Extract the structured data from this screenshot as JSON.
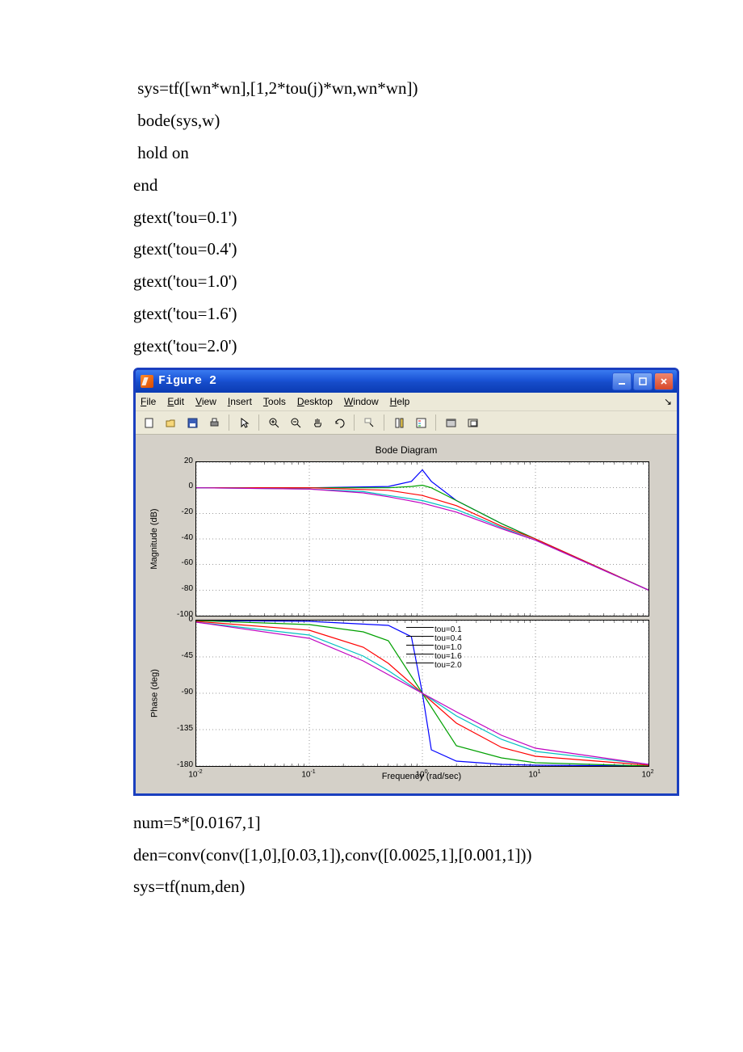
{
  "code_before": [
    " sys=tf([wn*wn],[1,2*tou(j)*wn,wn*wn])",
    " bode(sys,w)",
    " hold on",
    "end",
    "gtext('tou=0.1')",
    "gtext('tou=0.4')",
    "gtext('tou=1.0')",
    "gtext('tou=1.6')",
    "gtext('tou=2.0')"
  ],
  "code_after": [
    "num=5*[0.0167,1]",
    "den=conv(conv([1,0],[0.03,1]),conv([0.0025,1],[0.001,1]))",
    "sys=tf(num,den)"
  ],
  "figure": {
    "title": "Figure 2",
    "menu": [
      "File",
      "Edit",
      "View",
      "Insert",
      "Tools",
      "Desktop",
      "Window",
      "Help"
    ],
    "chart_title": "Bode Diagram"
  },
  "chart_data": [
    {
      "type": "line",
      "title": "Bode Diagram",
      "panel": "Magnitude",
      "ylabel": "Magnitude (dB)",
      "xlabel": "Frequency (rad/sec)",
      "xscale": "log",
      "xlim": [
        0.01,
        100
      ],
      "ylim": [
        -100,
        20
      ],
      "yticks": [
        20,
        0,
        -20,
        -40,
        -60,
        -80,
        -100
      ],
      "xticks": [
        0.01,
        0.1,
        1,
        10,
        100
      ],
      "series": [
        {
          "name": "tou=0.1",
          "color": "#0000ff",
          "x": [
            0.01,
            0.1,
            0.5,
            0.8,
            1,
            1.2,
            2,
            5,
            10,
            100
          ],
          "y": [
            0,
            0,
            1,
            5,
            14,
            5,
            -10,
            -28,
            -40,
            -80
          ]
        },
        {
          "name": "tou=0.4",
          "color": "#00a000",
          "x": [
            0.01,
            0.1,
            0.5,
            0.8,
            1,
            1.2,
            2,
            5,
            10,
            100
          ],
          "y": [
            0,
            0,
            0,
            1,
            2,
            0,
            -10,
            -28,
            -40,
            -80
          ]
        },
        {
          "name": "tou=1.0",
          "color": "#ff0000",
          "x": [
            0.01,
            0.1,
            0.5,
            1,
            2,
            5,
            10,
            100
          ],
          "y": [
            0,
            0,
            -2,
            -6,
            -14,
            -30,
            -40,
            -80
          ]
        },
        {
          "name": "tou=1.6",
          "color": "#00c0c0",
          "x": [
            0.01,
            0.1,
            0.3,
            0.5,
            1,
            2,
            5,
            10,
            100
          ],
          "y": [
            0,
            -1,
            -3,
            -6,
            -10,
            -17,
            -31,
            -41,
            -80
          ]
        },
        {
          "name": "tou=2.0",
          "color": "#c000c0",
          "x": [
            0.01,
            0.1,
            0.3,
            0.5,
            1,
            2,
            5,
            10,
            100
          ],
          "y": [
            0,
            -1,
            -4,
            -7,
            -12,
            -19,
            -32,
            -41,
            -80
          ]
        }
      ]
    },
    {
      "type": "line",
      "panel": "Phase",
      "ylabel": "Phase (deg)",
      "xlabel": "Frequency (rad/sec)",
      "xscale": "log",
      "xlim": [
        0.01,
        100
      ],
      "ylim": [
        -180,
        0
      ],
      "yticks": [
        0,
        -45,
        -90,
        -135,
        -180
      ],
      "xticks": [
        0.01,
        0.1,
        1,
        10,
        100
      ],
      "series": [
        {
          "name": "tou=0.1",
          "color": "#0000ff",
          "x": [
            0.01,
            0.1,
            0.5,
            0.8,
            1,
            1.2,
            2,
            5,
            10,
            100
          ],
          "y": [
            0,
            -1,
            -6,
            -20,
            -90,
            -160,
            -174,
            -178,
            -179,
            -180
          ]
        },
        {
          "name": "tou=0.4",
          "color": "#00a000",
          "x": [
            0.01,
            0.1,
            0.3,
            0.5,
            1,
            2,
            5,
            10,
            100
          ],
          "y": [
            0,
            -5,
            -14,
            -25,
            -90,
            -155,
            -170,
            -176,
            -180
          ]
        },
        {
          "name": "tou=1.0",
          "color": "#ff0000",
          "x": [
            0.01,
            0.1,
            0.3,
            0.5,
            1,
            2,
            5,
            10,
            100
          ],
          "y": [
            -1,
            -12,
            -33,
            -53,
            -90,
            -127,
            -157,
            -168,
            -179
          ]
        },
        {
          "name": "tou=1.6",
          "color": "#00c0c0",
          "x": [
            0.01,
            0.1,
            0.3,
            0.5,
            1,
            2,
            5,
            10,
            100
          ],
          "y": [
            -2,
            -18,
            -44,
            -62,
            -90,
            -118,
            -147,
            -162,
            -178
          ]
        },
        {
          "name": "tou=2.0",
          "color": "#c000c0",
          "x": [
            0.01,
            0.1,
            0.3,
            0.5,
            1,
            2,
            5,
            10,
            100
          ],
          "y": [
            -2,
            -22,
            -50,
            -67,
            -90,
            -113,
            -142,
            -158,
            -178
          ]
        }
      ],
      "annotations": [
        "tou=0.1",
        "tou=0.4",
        "tou=1.0",
        "tou=1.6",
        "tou=2.0"
      ]
    }
  ]
}
